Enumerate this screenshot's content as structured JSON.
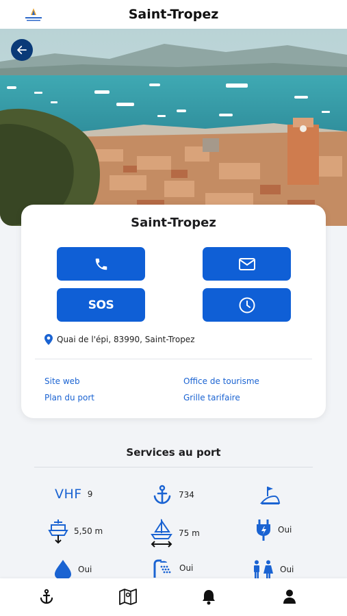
{
  "app": {
    "title": "Saint-Tropez"
  },
  "card": {
    "title": "Saint-Tropez",
    "buttons": {
      "sos_label": "SOS"
    },
    "address": "Quai de l'épi, 83990, Saint-Tropez",
    "links": {
      "website": "Site web",
      "tourism": "Office de tourisme",
      "port_map": "Plan du port",
      "rates": "Grille tarifaire"
    }
  },
  "services": {
    "title": "Services au port",
    "items": [
      {
        "icon": "vhf-text",
        "label": "VHF",
        "value": "9"
      },
      {
        "icon": "anchor-icon",
        "value": "734"
      },
      {
        "icon": "slipway-icon",
        "value": ""
      },
      {
        "icon": "draft-icon",
        "value": "5,50 m"
      },
      {
        "icon": "boat-length-icon",
        "value": "75 m"
      },
      {
        "icon": "electricity-icon",
        "value": "Oui"
      },
      {
        "icon": "water-icon",
        "value": "Oui"
      },
      {
        "icon": "shower-icon",
        "value": "Oui"
      },
      {
        "icon": "toilets-icon",
        "value": "Oui"
      }
    ]
  },
  "colors": {
    "primary": "#0f5fd6",
    "back_button": "#0a3a78",
    "link": "#1a63d2"
  },
  "nav": [
    "anchor-icon",
    "map-icon",
    "bell-icon",
    "user-icon"
  ]
}
